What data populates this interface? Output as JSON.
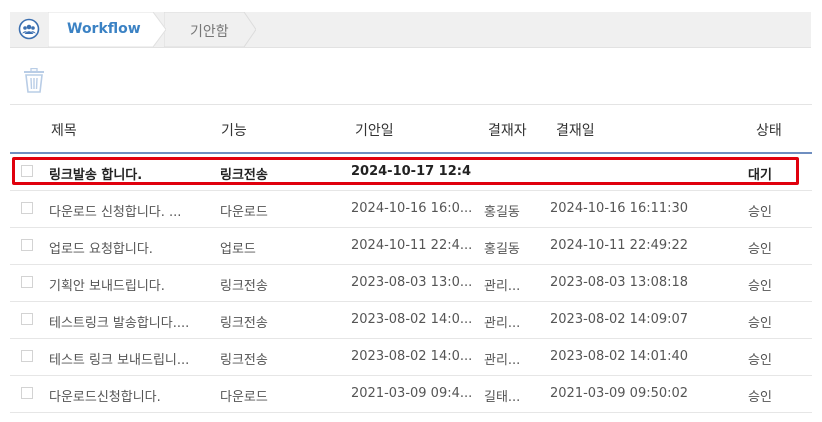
{
  "breadcrumb": {
    "root_label": "Workflow",
    "current_label": "기안함"
  },
  "colors": {
    "accent": "#3b82c4",
    "highlight": "#e0000d",
    "header_rule": "#6f8ec0"
  },
  "table": {
    "headers": {
      "title": "제목",
      "function": "기능",
      "draft_date": "기안일",
      "approver": "결재자",
      "approval_date": "결재일",
      "status": "상태"
    },
    "rows": [
      {
        "title": "링크발송 합니다.",
        "function": "링크전송",
        "draft_date": "2024-10-17 12:4...",
        "approver": "",
        "approval_date": "",
        "status": "대기"
      },
      {
        "title": "다운로드 신청합니다. ...",
        "function": "다운로드",
        "draft_date": "2024-10-16 16:0...",
        "approver": "홍길동",
        "approval_date": "2024-10-16 16:11:30",
        "status": "승인"
      },
      {
        "title": "업로드 요청합니다.",
        "function": "업로드",
        "draft_date": "2024-10-11 22:4...",
        "approver": "홍길동",
        "approval_date": "2024-10-11 22:49:22",
        "status": "승인"
      },
      {
        "title": "기획안 보내드립니다.",
        "function": "링크전송",
        "draft_date": "2023-08-03 13:0...",
        "approver": "관리...",
        "approval_date": "2023-08-03 13:08:18",
        "status": "승인"
      },
      {
        "title": "테스트링크 발송합니다....",
        "function": "링크전송",
        "draft_date": "2023-08-02 14:0...",
        "approver": "관리...",
        "approval_date": "2023-08-02 14:09:07",
        "status": "승인"
      },
      {
        "title": "테스트 링크 보내드립니...",
        "function": "링크전송",
        "draft_date": "2023-08-02 14:0...",
        "approver": "관리...",
        "approval_date": "2023-08-02 14:01:40",
        "status": "승인"
      },
      {
        "title": "다운로드신청합니다.",
        "function": "다운로드",
        "draft_date": "2021-03-09 09:4...",
        "approver": "길태...",
        "approval_date": "2021-03-09 09:50:02",
        "status": "승인"
      }
    ]
  }
}
